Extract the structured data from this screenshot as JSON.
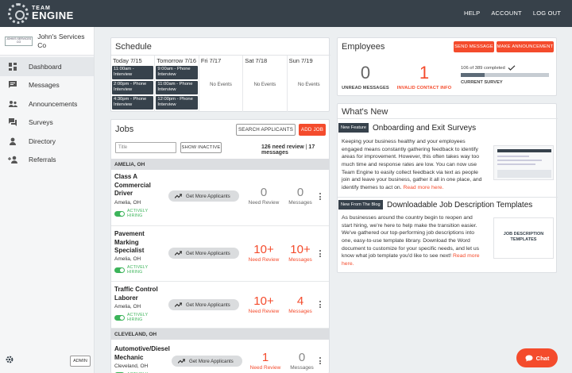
{
  "header": {
    "logo_line1": "TEAM",
    "logo_line2": "ENGINE",
    "nav": [
      "HELP",
      "ACCOUNT",
      "LOG OUT"
    ]
  },
  "sidebar": {
    "company_logo_text": "JOHN'S SERVICES CO",
    "company_name": "John's Services Co",
    "items": [
      {
        "label": "Dashboard",
        "icon": "dashboard-icon"
      },
      {
        "label": "Messages",
        "icon": "message-icon"
      },
      {
        "label": "Announcements",
        "icon": "megaphone-icon"
      },
      {
        "label": "Surveys",
        "icon": "survey-icon"
      },
      {
        "label": "Directory",
        "icon": "person-icon"
      },
      {
        "label": "Referrals",
        "icon": "add-person-icon"
      }
    ],
    "admin_label": "ADMIN"
  },
  "schedule": {
    "title": "Schedule",
    "days": [
      {
        "label": "Today 7/15",
        "events": [
          "11:00am - Interview",
          "2:00pm - Phone Interview",
          "4:30pm - Phone Interview"
        ]
      },
      {
        "label": "Tomorrow 7/16",
        "events": [
          "9:00am - Phone Interview",
          "11:00am - Phone Interview",
          "12:00pm - Phone Interview"
        ]
      },
      {
        "label": "Fri 7/17",
        "events": [],
        "empty": "No Events"
      },
      {
        "label": "Sat 7/18",
        "events": [],
        "empty": "No Events"
      },
      {
        "label": "Sun 7/19",
        "events": [],
        "empty": "No Events"
      }
    ]
  },
  "jobs": {
    "title": "Jobs",
    "search_label": "SEARCH APPLICANTS",
    "add_label": "ADD JOB",
    "title_placeholder": "Title",
    "show_inactive_label": "SHOW INACTIVE",
    "summary_review": "126 need review",
    "summary_sep": " | ",
    "summary_messages": "17 messages",
    "get_more_label": "Get More Applicants",
    "review_label": "Need Review",
    "messages_label": "Messages",
    "hiring_line1": "ACTIVELY",
    "hiring_line2": "HIRING",
    "locations": [
      {
        "name": "AMELIA, OH",
        "jobs": [
          {
            "title": "Class A Commercial Driver",
            "location": "Amelia, OH",
            "review": "0",
            "messages": "0"
          },
          {
            "title": "Pavement Marking Specialist",
            "location": "Amelia, OH",
            "review": "10+",
            "messages": "10+"
          },
          {
            "title": "Traffic Control Laborer",
            "location": "Amelia, OH",
            "review": "10+",
            "messages": "4"
          }
        ]
      },
      {
        "name": "CLEVELAND, OH",
        "jobs": [
          {
            "title": "Automotive/Diesel Mechanic",
            "location": "Cleveland, OH",
            "review": "1",
            "messages": "0"
          }
        ]
      }
    ]
  },
  "employees": {
    "title": "Employees",
    "send_label": "SEND MESSAGE",
    "announce_label": "MAKE ANNOUNCEMENT",
    "unread_value": "0",
    "unread_label": "UNREAD MESSAGES",
    "invalid_value": "1",
    "invalid_label": "INVALID CONTACT INFO",
    "survey_text": "106 of 389 completed",
    "survey_label": "CURRENT SURVEY",
    "survey_completed": 106,
    "survey_total": 389,
    "accent_color": "#f44b2c"
  },
  "whats_new": {
    "title": "What's New",
    "items": [
      {
        "badge": "New Feature",
        "heading": "Onboarding and Exit Surveys",
        "body": "Keeping your business healthy and your employees engaged means constantly gathering feedback to identify areas for improvement. However, this often takes way too much time and response rates are low. You can now use Team Engine to easily collect feedback via text as people join and leave your business, gather it all in one place, and identify themes to act on.",
        "more": "Read more here."
      },
      {
        "badge": "New From The Blog",
        "heading": "Downloadable Job Description Templates",
        "body": "As businesses around the country begin to reopen and start hiring, we're here to help make the transition easier. We've gathered our top-performing job descriptions into one, easy-to-use template library. Download the Word document to customize for your specific needs, and let us know what job template you'd like to see next!",
        "more": "Read more here.",
        "image_text1": "JOB DESCRIPTION",
        "image_text2": "TEMPLATES"
      }
    ]
  },
  "chat": {
    "label": "Chat"
  }
}
